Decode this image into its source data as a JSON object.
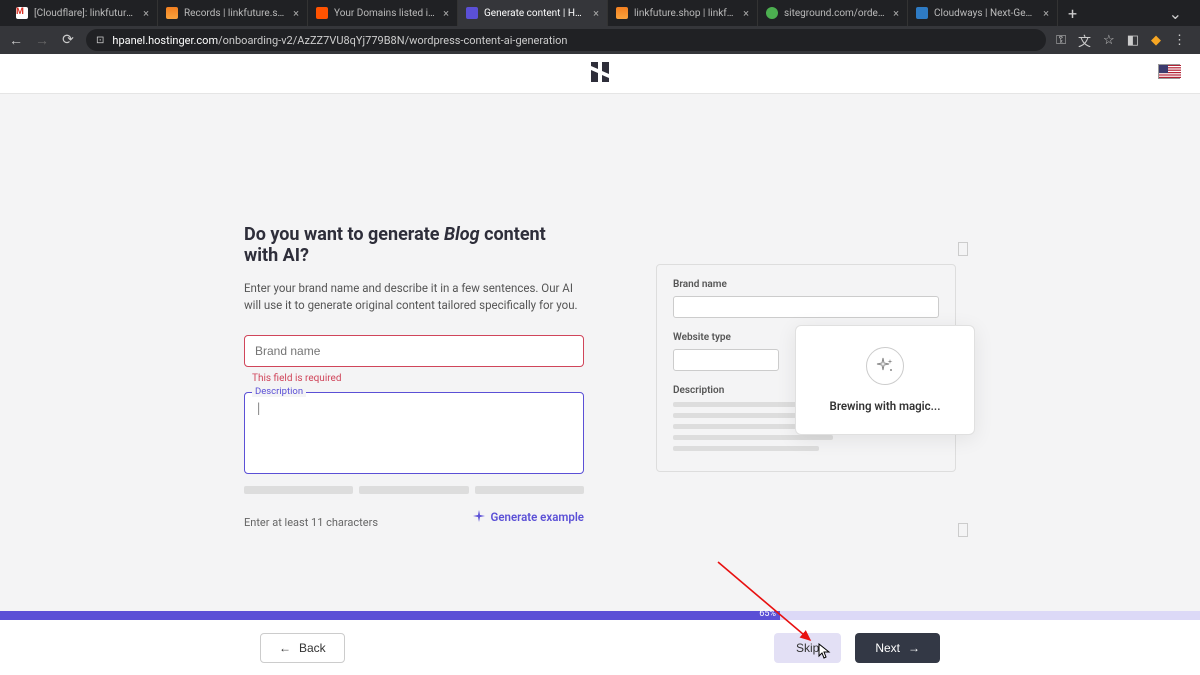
{
  "browser": {
    "tabs": [
      {
        "title": "[Cloudflare]: linkfuture.shop |"
      },
      {
        "title": "Records | linkfuture.shop | M"
      },
      {
        "title": "Your Domains listed in one pl"
      },
      {
        "title": "Generate content | Hostinger"
      },
      {
        "title": "linkfuture.shop | linkfuture.sh"
      },
      {
        "title": "siteground.com/order-verific"
      },
      {
        "title": "Cloudways | Next-Gen Cloud"
      }
    ],
    "url_host": "hpanel.hostinger.com",
    "url_path": "/onboarding-v2/AzZZ7VU8qYj779B8N/wordpress-content-ai-generation"
  },
  "page": {
    "heading_pre": "Do you want to generate ",
    "heading_em": "Blog",
    "heading_post": " content with AI?",
    "subtext": "Enter your brand name and describe it in a few sentences. Our AI will use it to generate original content tailored specifically for you.",
    "brand_placeholder": "Brand name",
    "brand_error": "This field is required",
    "desc_label": "Description",
    "hint": "Enter at least 11 characters",
    "generate_example": "Generate example"
  },
  "preview": {
    "brand_label": "Brand name",
    "type_label": "Website type",
    "desc_label": "Description",
    "overlay_text": "Brewing with magic..."
  },
  "footer": {
    "back": "Back",
    "skip": "Skip",
    "next": "Next",
    "progress_pct": "65%"
  }
}
